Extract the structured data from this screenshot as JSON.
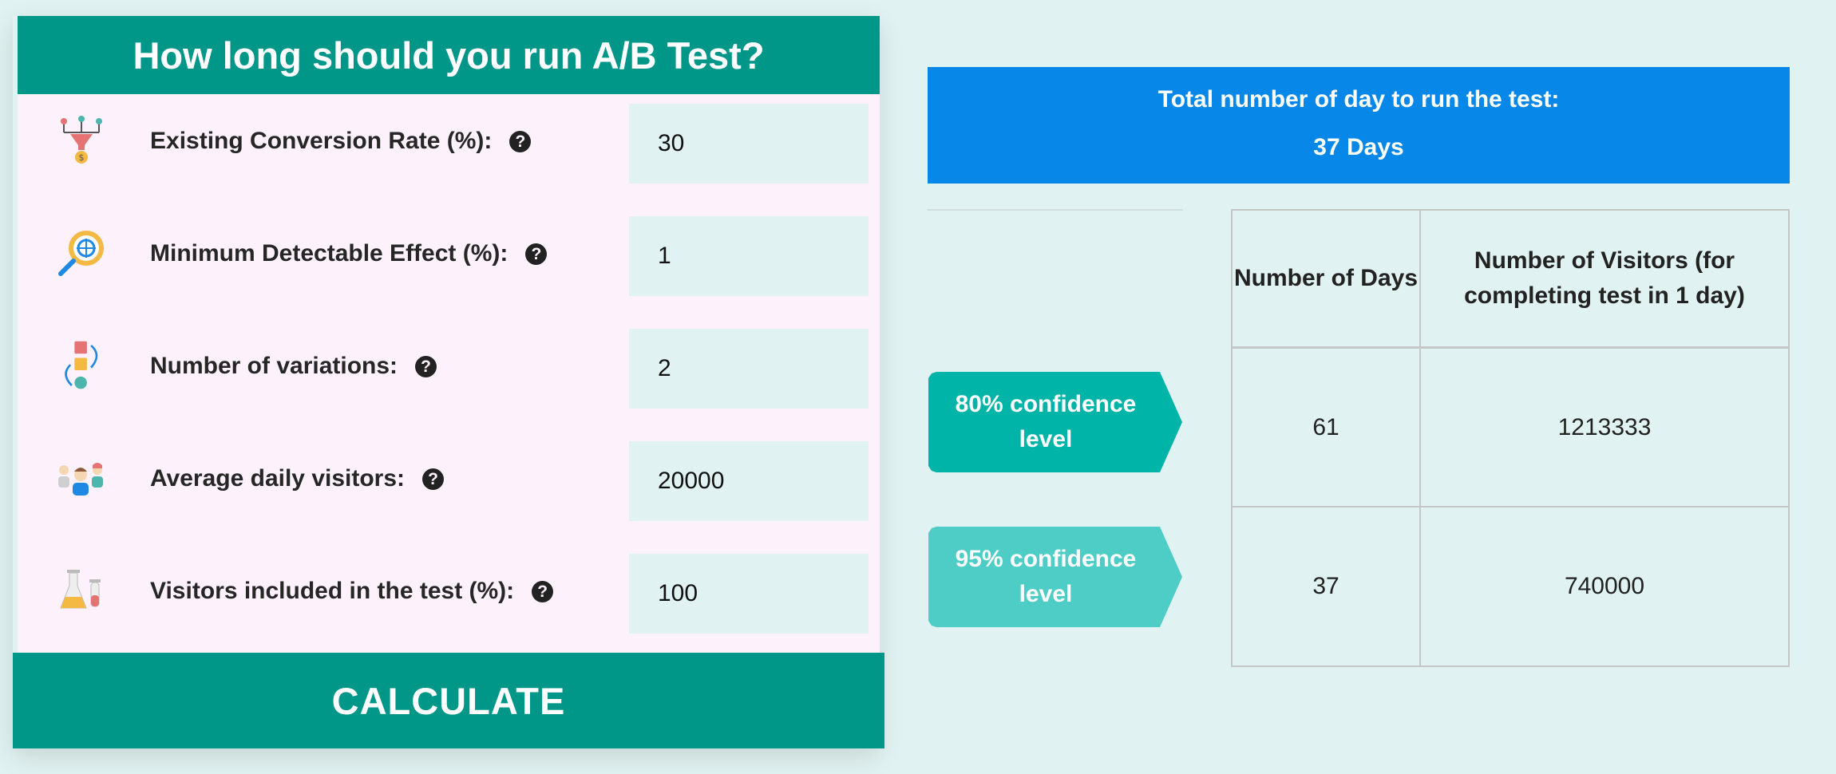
{
  "header": {
    "title": "How long should you run A/B Test?"
  },
  "fields": [
    {
      "label": "Existing Conversion Rate (%):",
      "value": "30",
      "icon": "funnel-conversion-icon"
    },
    {
      "label": "Minimum Detectable Effect (%):",
      "value": "1",
      "icon": "magnifier-target-icon"
    },
    {
      "label": "Number of variations:",
      "value": "2",
      "icon": "shapes-variations-icon"
    },
    {
      "label": "Average daily visitors:",
      "value": "20000",
      "icon": "people-visitors-icon"
    },
    {
      "label": "Visitors included in the test (%):",
      "value": "100",
      "icon": "lab-flask-icon"
    }
  ],
  "help_glyph": "?",
  "button": {
    "label": "CALCULATE"
  },
  "result": {
    "title": "Total number of day to run the test:",
    "value": "37 Days"
  },
  "table": {
    "headers": [
      "Number of Days",
      "Number of Visitors (for completing test in 1 day)"
    ],
    "rows": [
      {
        "label": "80% confidence level",
        "days": "61",
        "visitors": "1213333"
      },
      {
        "label": "95% confidence level",
        "days": "37",
        "visitors": "740000"
      }
    ]
  },
  "colors": {
    "accent": "#009688",
    "result_bg": "#0788e8",
    "badge_80": "#00b5a8",
    "badge_95": "#4dcdc6",
    "page_bg": "#e0f2f1",
    "form_bg": "#fdf1fb"
  }
}
